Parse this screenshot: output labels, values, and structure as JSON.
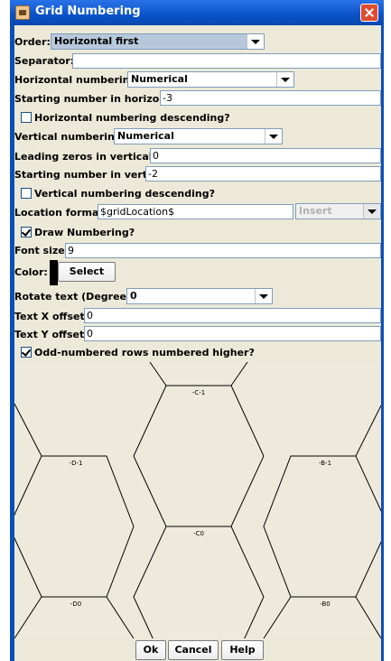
{
  "window": {
    "title": "Grid Numbering",
    "close_icon": "close-icon"
  },
  "fields": {
    "order": {
      "label": "Order:",
      "value": "Horizontal first"
    },
    "separator": {
      "label": "Separator:",
      "value": ""
    },
    "h_numbering": {
      "label": "Horizontal numbering:",
      "value": "Numerical"
    },
    "h_start": {
      "label": "Starting number in horizontal:",
      "value": "-3"
    },
    "h_desc": {
      "label": "Horizontal numbering descending?",
      "checked": false
    },
    "v_numbering": {
      "label": "Vertical numbering:",
      "value": "Numerical"
    },
    "v_zeros": {
      "label": "Leading zeros in vertical:",
      "value": "0"
    },
    "v_start": {
      "label": "Starting number in vertical:",
      "value": "-2"
    },
    "v_desc": {
      "label": "Vertical numbering descending?",
      "checked": false
    },
    "location": {
      "label": "Location format:",
      "value": "$gridLocation$",
      "insert_label": "Insert"
    },
    "draw": {
      "label": "Draw Numbering?",
      "checked": true
    },
    "font_size": {
      "label": "Font size:",
      "value": "9"
    },
    "color": {
      "label": "Color:",
      "swatch": "#000000",
      "button": "Select"
    },
    "rotate": {
      "label": "Rotate text (Degrees):",
      "value": "0"
    },
    "x_offset": {
      "label": "Text X offset:",
      "value": "0"
    },
    "y_offset": {
      "label": "Text Y offset:",
      "value": "0"
    },
    "odd_rows": {
      "label": "Odd-numbered rows numbered higher?",
      "checked": true
    }
  },
  "preview": {
    "hex_labels": [
      "-C-1",
      "-D-1",
      "-B-1",
      "-C0",
      "-D0",
      "-B0"
    ]
  },
  "buttons": {
    "ok": "Ok",
    "cancel": "Cancel",
    "help": "Help"
  },
  "colors": {
    "titlebar": "#0a52c8",
    "panel": "#ece9d8",
    "preview_bg": "#eeeadb"
  }
}
